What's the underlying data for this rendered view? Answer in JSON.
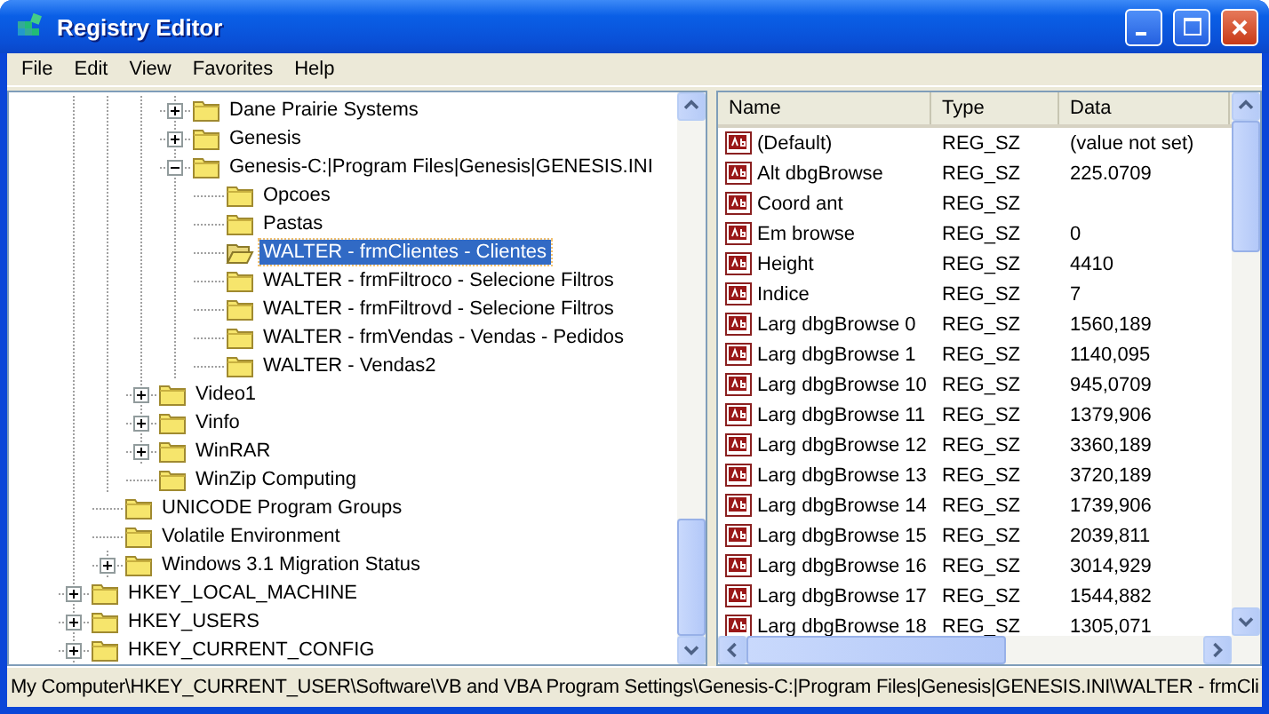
{
  "window": {
    "title": "Registry Editor"
  },
  "menu": [
    {
      "label": "File"
    },
    {
      "label": "Edit"
    },
    {
      "label": "View"
    },
    {
      "label": "Favorites"
    },
    {
      "label": "Help"
    }
  ],
  "tree": {
    "items": [
      {
        "children": [
          {
            "children": [
              {
                "children": [
                  {
                    "label": "Dane Prairie Systems",
                    "expanded": false,
                    "selected": false
                  },
                  {
                    "label": "Genesis",
                    "expanded": false,
                    "selected": false
                  },
                  {
                    "label": "Genesis-C:|Program Files|Genesis|GENESIS.INI",
                    "expanded": true,
                    "selected": false,
                    "children": [
                      {
                        "label": "Opcoes",
                        "selected": false
                      },
                      {
                        "label": "Pastas",
                        "selected": false
                      },
                      {
                        "label": "WALTER - frmClientes - Clientes",
                        "selected": true
                      },
                      {
                        "label": "WALTER - frmFiltroco - Selecione Filtros",
                        "selected": false
                      },
                      {
                        "label": "WALTER - frmFiltrovd - Selecione Filtros",
                        "selected": false
                      },
                      {
                        "label": "WALTER - frmVendas - Vendas - Pedidos",
                        "selected": false
                      },
                      {
                        "label": "WALTER - Vendas2",
                        "selected": false
                      }
                    ]
                  }
                ]
              },
              {
                "label": "Video1",
                "expanded": false,
                "selected": false
              },
              {
                "label": "Vinfo",
                "expanded": false,
                "selected": false
              },
              {
                "label": "WinRAR",
                "expanded": false,
                "selected": false
              },
              {
                "label": "WinZip Computing",
                "selected": false
              }
            ]
          },
          {
            "label": "UNICODE Program Groups",
            "selected": false
          },
          {
            "label": "Volatile Environment",
            "selected": false
          },
          {
            "label": "Windows 3.1 Migration Status",
            "expanded": false,
            "selected": false
          }
        ]
      },
      {
        "label": "HKEY_LOCAL_MACHINE",
        "expanded": false,
        "selected": false
      },
      {
        "label": "HKEY_USERS",
        "expanded": false,
        "selected": false
      },
      {
        "label": "HKEY_CURRENT_CONFIG",
        "expanded": false,
        "selected": false
      }
    ]
  },
  "values": {
    "columns": [
      "Name",
      "Type",
      "Data"
    ],
    "rows": [
      {
        "name": "(Default)",
        "type": "REG_SZ",
        "data": "(value not set)"
      },
      {
        "name": "Alt dbgBrowse",
        "type": "REG_SZ",
        "data": "225.0709"
      },
      {
        "name": "Coord ant",
        "type": "REG_SZ"
      },
      {
        "name": "Em browse",
        "type": "REG_SZ",
        "data": "0"
      },
      {
        "name": "Height",
        "type": "REG_SZ",
        "data": "4410"
      },
      {
        "name": "Indice",
        "type": "REG_SZ",
        "data": "7"
      },
      {
        "name": "Larg dbgBrowse 0",
        "type": "REG_SZ",
        "data": "1560,189"
      },
      {
        "name": "Larg dbgBrowse 1",
        "type": "REG_SZ",
        "data": "1140,095"
      },
      {
        "name": "Larg dbgBrowse 10",
        "type": "REG_SZ",
        "data": "945,0709"
      },
      {
        "name": "Larg dbgBrowse 11",
        "type": "REG_SZ",
        "data": "1379,906"
      },
      {
        "name": "Larg dbgBrowse 12",
        "type": "REG_SZ",
        "data": "3360,189"
      },
      {
        "name": "Larg dbgBrowse 13",
        "type": "REG_SZ",
        "data": "3720,189"
      },
      {
        "name": "Larg dbgBrowse 14",
        "type": "REG_SZ",
        "data": "1739,906"
      },
      {
        "name": "Larg dbgBrowse 15",
        "type": "REG_SZ",
        "data": "2039,811"
      },
      {
        "name": "Larg dbgBrowse 16",
        "type": "REG_SZ",
        "data": "3014,929"
      },
      {
        "name": "Larg dbgBrowse 17",
        "type": "REG_SZ",
        "data": "1544,882"
      },
      {
        "name": "Larg dbgBrowse 18",
        "type": "REG_SZ",
        "data": "1305,071"
      }
    ]
  },
  "status_bar": "My Computer\\HKEY_CURRENT_USER\\Software\\VB and VBA Program Settings\\Genesis-C:|Program Files|Genesis|GENESIS.INI\\WALTER - frmCli"
}
